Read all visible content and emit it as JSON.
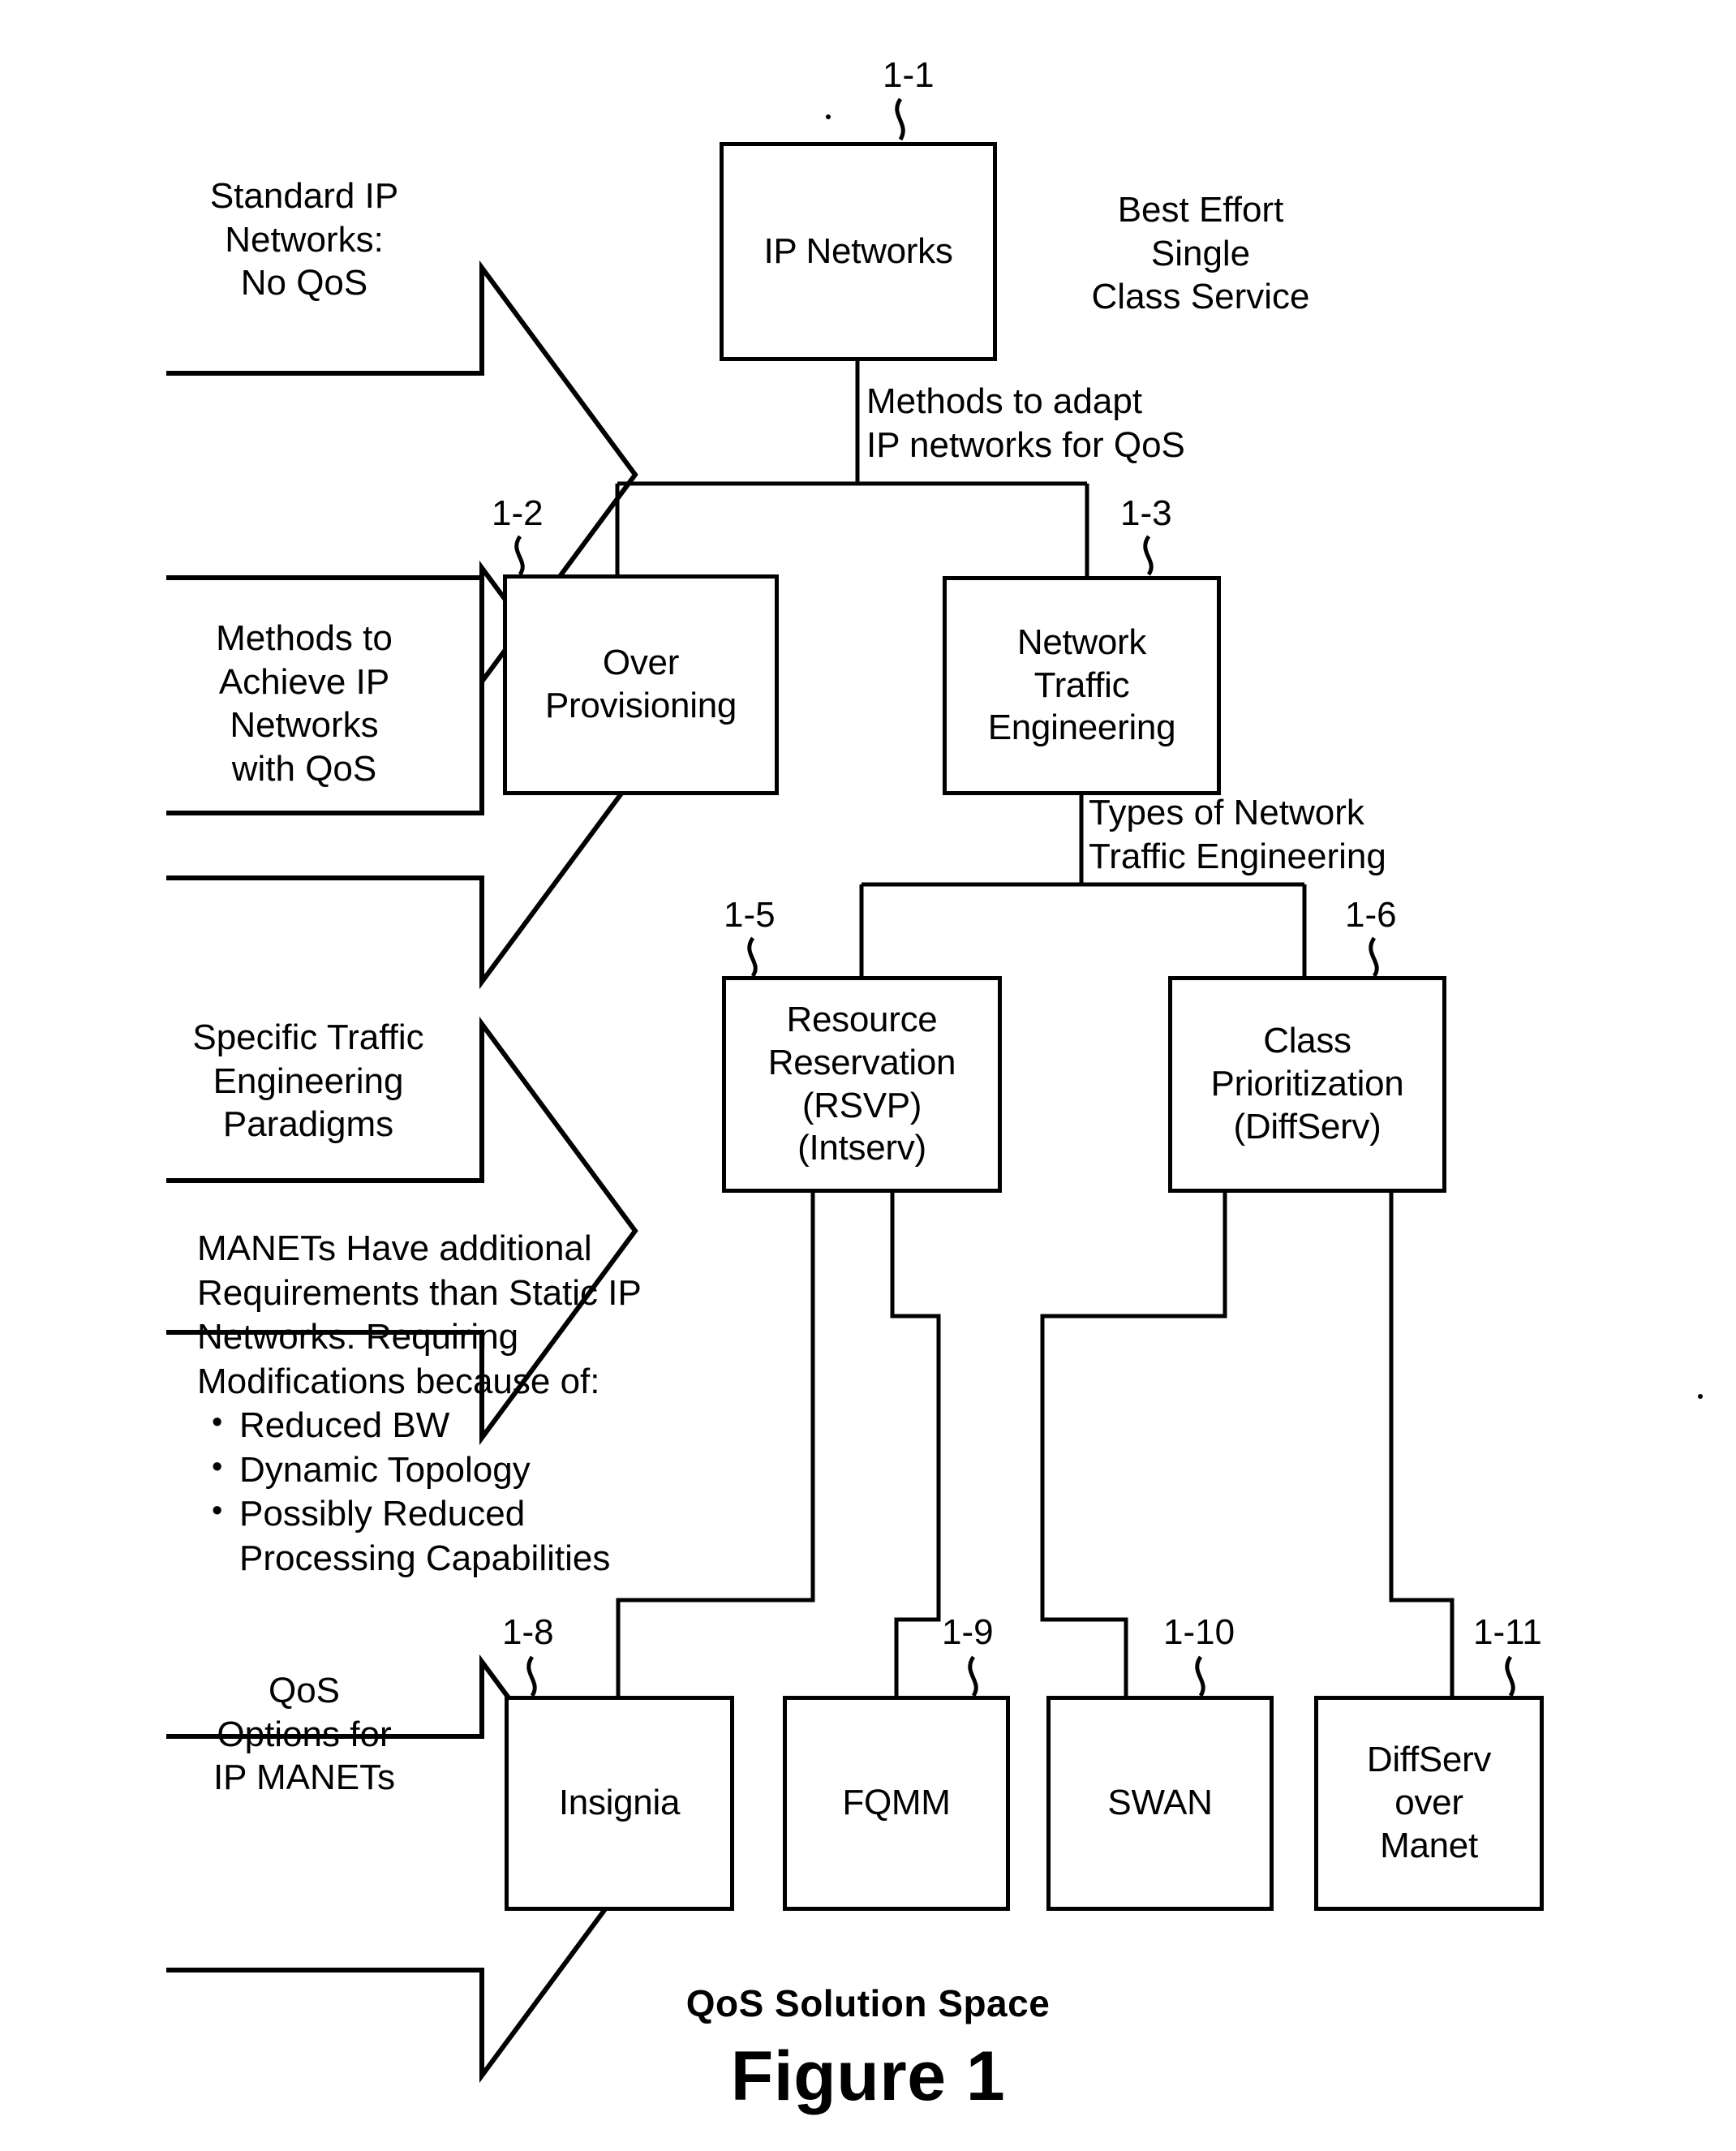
{
  "figure": {
    "caption_subtitle": "QoS Solution Space",
    "caption_title": "Figure 1"
  },
  "stage_arrows": [
    {
      "id": "arrow-standard-ip",
      "label": "Standard IP\nNetworks:\nNo QoS"
    },
    {
      "id": "arrow-methods-achieve",
      "label": "Methods to\nAchieve IP\nNetworks\nwith QoS"
    },
    {
      "id": "arrow-specific-paradigms",
      "label": "Specific Traffic\nEngineering\nParadigms"
    },
    {
      "id": "arrow-qos-options",
      "label": "QoS\nOptions for\nIP MANETs"
    }
  ],
  "nodes": [
    {
      "id": "ip-networks",
      "ref": "1-1",
      "label": "IP Networks"
    },
    {
      "id": "over-provisioning",
      "ref": "1-2",
      "label": "Over\nProvisioning"
    },
    {
      "id": "network-traffic-eng",
      "ref": "1-3",
      "label": "Network\nTraffic\nEngineering"
    },
    {
      "id": "resource-reservation",
      "ref": "1-5",
      "label": "Resource\nReservation\n(RSVP)\n(Intserv)"
    },
    {
      "id": "class-prioritization",
      "ref": "1-6",
      "label": "Class\nPrioritization\n(DiffServ)"
    },
    {
      "id": "insignia",
      "ref": "1-8",
      "label": "Insignia"
    },
    {
      "id": "fqmm",
      "ref": "1-9",
      "label": "FQMM"
    },
    {
      "id": "swan",
      "ref": "1-10",
      "label": "SWAN"
    },
    {
      "id": "diffserv-over-manet",
      "ref": "1-11",
      "label": "DiffServ\nover\nManet"
    }
  ],
  "annotations": {
    "best_effort": "Best Effort\nSingle\nClass Service",
    "methods_to_adapt": "Methods to adapt\nIP networks for QoS",
    "types_of_nte": "Types of Network\nTraffic Engineering"
  },
  "manet_note": {
    "intro": "MANETs Have additional\nRequirements than Static IP\nNetworks: Requiring\nModifications because of:",
    "bullets": [
      "Reduced BW",
      "Dynamic Topology",
      "Possibly Reduced\nProcessing Capabilities"
    ]
  },
  "colors": {
    "ink": "#000000",
    "paper": "#ffffff"
  }
}
